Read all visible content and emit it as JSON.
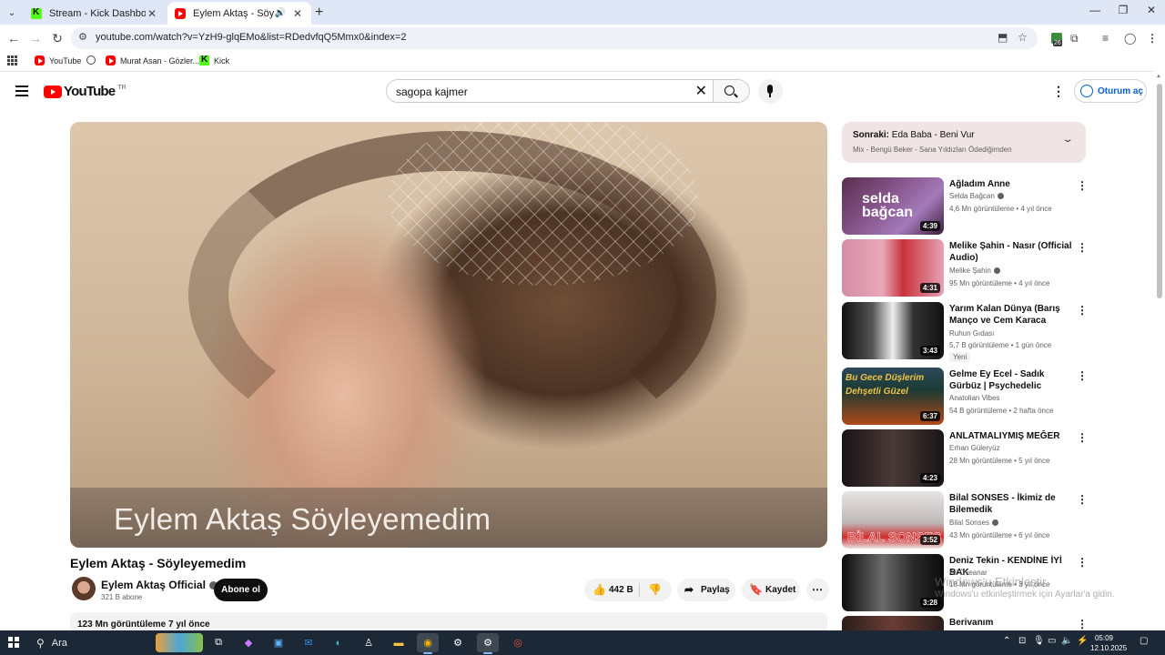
{
  "browser": {
    "tabs": [
      {
        "title": "Stream - Kick Dashboard",
        "favicon": "kick-icon",
        "active": false
      },
      {
        "title": "Eylem Aktaş - Söyleyemedi",
        "favicon": "youtube-icon",
        "active": true,
        "audio": true
      }
    ],
    "url": "youtube.com/watch?v=YzH9-glqEMo&list=RDedvfqQ5Mmx0&index=2",
    "extension_badge": "26",
    "bookmarks": [
      "YouTube",
      "Murat Asan - Gözler...",
      "Kick"
    ]
  },
  "youtube": {
    "logo_text": "YouTube",
    "country_code": "TR",
    "search_value": "sagopa kajmer",
    "signin_label": "Oturum aç"
  },
  "video": {
    "overlay_text": "Eylem Aktaş Söyleyemedim",
    "title": "Eylem Aktaş - Söyleyemedim",
    "channel": "Eylem Aktaş Official",
    "subscribers": "321 B abone",
    "subscribe_label": "Abone ol",
    "likes": "442 B",
    "share_label": "Paylaş",
    "save_label": "Kaydet",
    "views_age": "123 Mn görüntüleme  7 yıl önce"
  },
  "next_up": {
    "prefix": "Sonraki:",
    "title": "Eda Baba - Beni Vur",
    "subtitle": "Mix - Bengü Beker - Sana Yıldızları Ödediğimden"
  },
  "recommendations": [
    {
      "title": "Ağladım Anne",
      "channel": "Selda Bağcan",
      "verified": true,
      "meta": "4,6 Mn görüntüleme • 4 yıl önce",
      "duration": "4:39",
      "thumb_text": "selda bağcan"
    },
    {
      "title": "Melike Şahin - Nasır (Official Audio)",
      "channel": "Melike Şahin",
      "verified": true,
      "meta": "95 Mn görüntüleme • 4 yıl önce",
      "duration": "4:31"
    },
    {
      "title": "Yarım Kalan Dünya (Barış Manço ve Cem Karaca Anısına)",
      "channel": "Ruhun Gıdası",
      "verified": false,
      "meta": "5,7 B görüntüleme • 1 gün önce",
      "duration": "3:43",
      "badge": "Yeni"
    },
    {
      "title": "Gelme Ey Ecel - Sadık Gürbüz | Psychedelic Anatolian Rock ...",
      "channel": "Anatolian Vibes",
      "verified": false,
      "meta": "54 B görüntüleme • 2 hafta önce",
      "duration": "6:37",
      "thumb_text": "Bu Gece Düşlerim Dehşetli Güzel"
    },
    {
      "title": "ANLATMALIYMIŞ MEĞER",
      "channel": "Erhan Güleryüz",
      "verified": false,
      "meta": "28 Mn görüntüleme • 5 yıl önce",
      "duration": "4:23"
    },
    {
      "title": "Bilal SONSES - İkimiz de Bilemedik",
      "channel": "Bilal Sonses",
      "verified": true,
      "meta": "43 Mn görüntüleme • 6 yıl önce",
      "duration": "3:52",
      "thumb_text": "BİLAL SONSES"
    },
    {
      "title": "Deniz Tekin - KENDİNE İYİ BAK",
      "channel": "Ali Öveanar",
      "verified": false,
      "meta": "18 Mn görüntüleme • 3 yıl önce",
      "duration": "3:28"
    },
    {
      "title": "Berivanım",
      "channel": "",
      "verified": false,
      "meta": "",
      "duration": ""
    }
  ],
  "watermark": {
    "line1": "Windows'u Etkinleştir",
    "line2": "Windows'u etkinleştirmek için Ayarlar'a gidin."
  },
  "taskbar": {
    "search_label": "Ara",
    "time": "05:09",
    "date": "12.10.2025"
  }
}
